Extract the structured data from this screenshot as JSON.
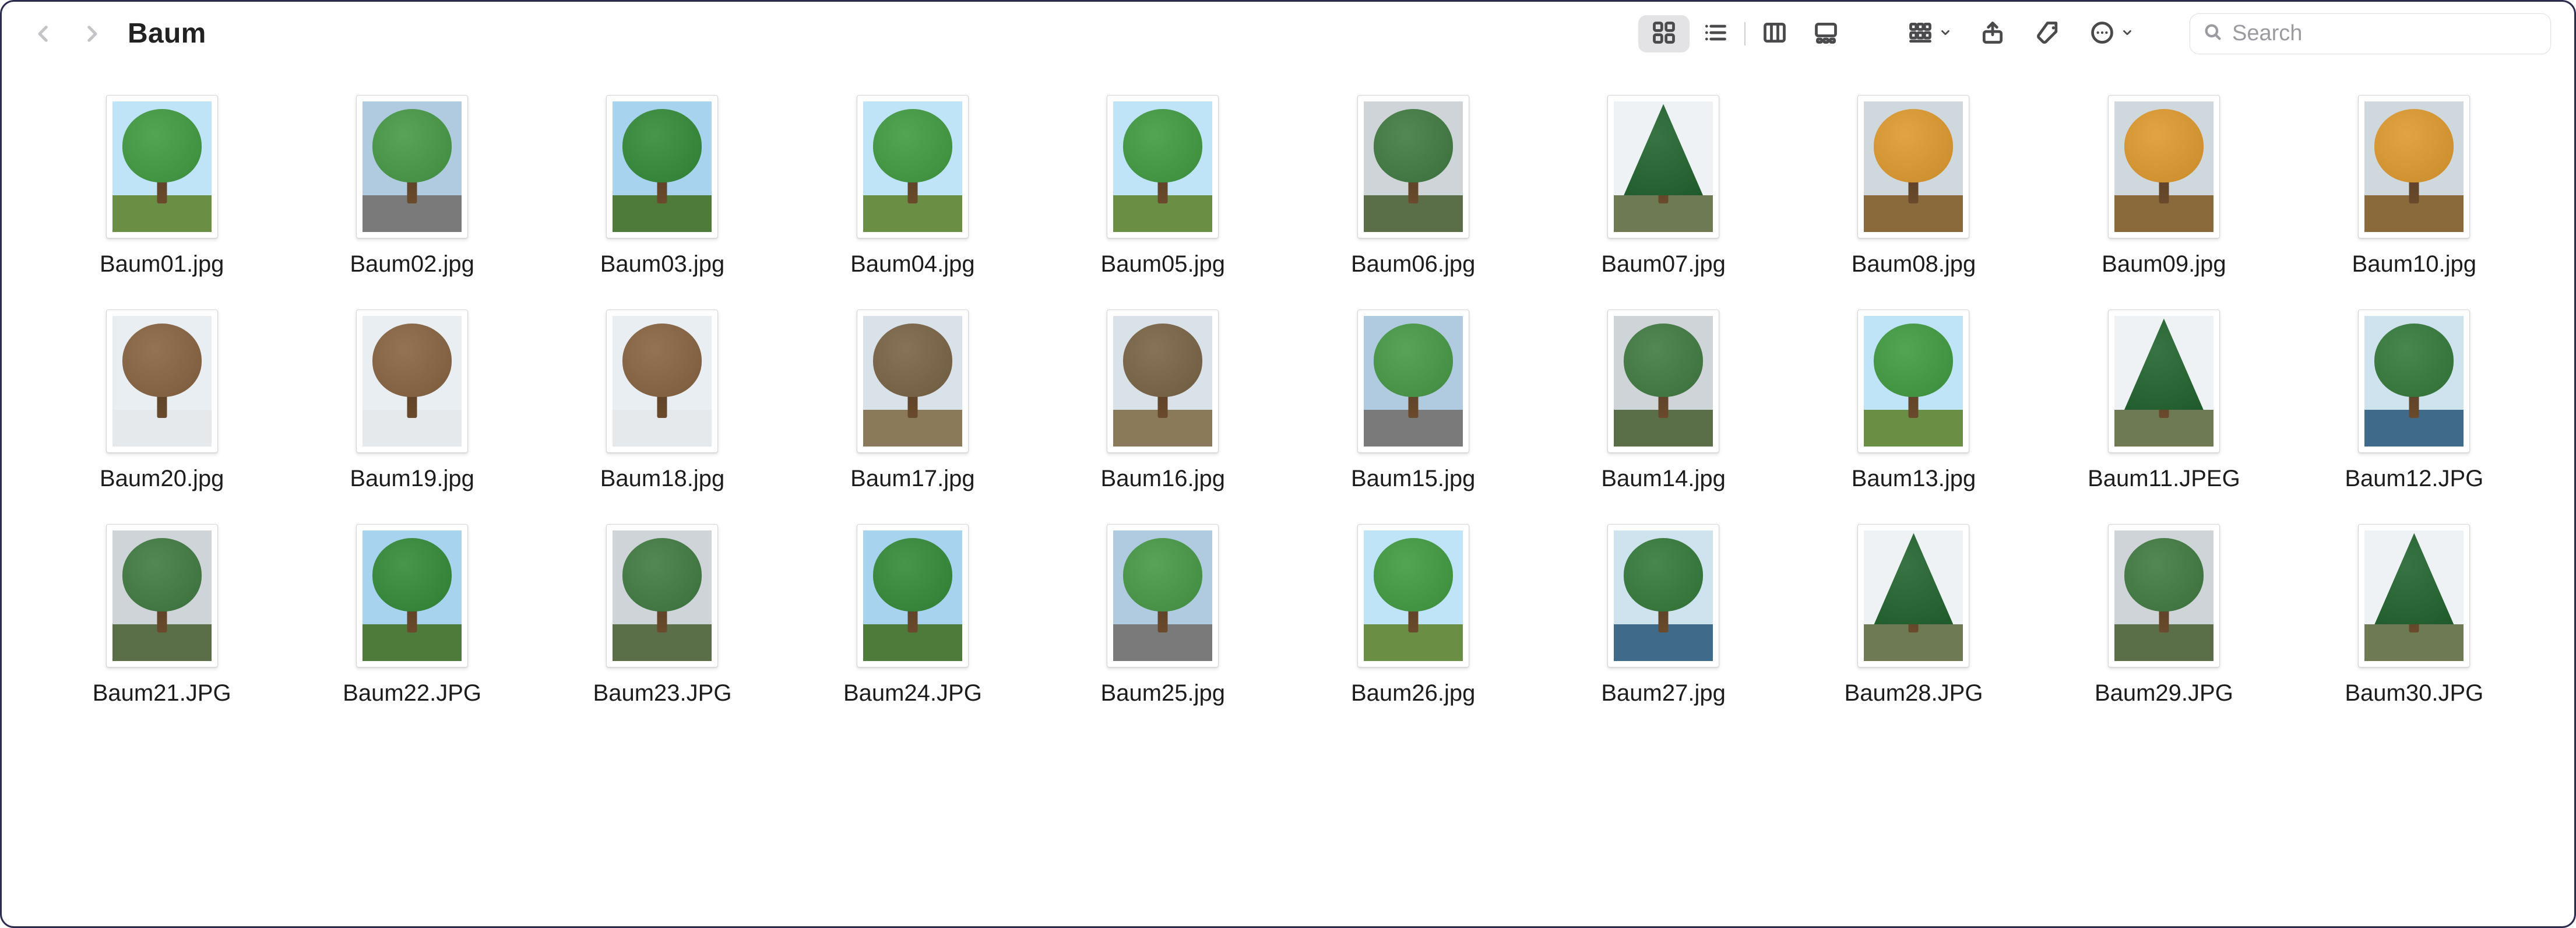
{
  "header": {
    "title": "Baum",
    "search_placeholder": "Search"
  },
  "palettes": {
    "spring": {
      "sky": "#a8d3ef",
      "ground": "#4e7a3a",
      "crown": "#2e7d32"
    },
    "summer": {
      "sky": "#bfe3f7",
      "ground": "#6a8f44",
      "crown": "#3a8c3a"
    },
    "autumn": {
      "sky": "#cfd8dc",
      "ground": "#8a6a3a",
      "crown": "#c98a2a"
    },
    "winter": {
      "sky": "#e8eef2",
      "ground": "#e5e9ec",
      "crown": "#7a5a3a"
    },
    "bare": {
      "sky": "#d9e2e8",
      "ground": "#8a7a5a",
      "crown": "#6e5a3e"
    },
    "pine": {
      "sky": "#eef2f4",
      "ground": "#6e7a54",
      "crown": "#1f5a2a"
    },
    "urban": {
      "sky": "#b0cbe0",
      "ground": "#7a7a7a",
      "crown": "#3f8a3f"
    },
    "lake": {
      "sky": "#cfe3ef",
      "ground": "#3f6a8a",
      "crown": "#2f6e34"
    },
    "overcast": {
      "sky": "#cfd4d8",
      "ground": "#5a6e48",
      "crown": "#3a6e3a"
    }
  },
  "files": [
    {
      "name": "Baum01.jpg",
      "palette": "summer",
      "shape": "round"
    },
    {
      "name": "Baum02.jpg",
      "palette": "urban",
      "shape": "round"
    },
    {
      "name": "Baum03.jpg",
      "palette": "spring",
      "shape": "round"
    },
    {
      "name": "Baum04.jpg",
      "palette": "summer",
      "shape": "round"
    },
    {
      "name": "Baum05.jpg",
      "palette": "summer",
      "shape": "round"
    },
    {
      "name": "Baum06.jpg",
      "palette": "overcast",
      "shape": "round"
    },
    {
      "name": "Baum07.jpg",
      "palette": "pine",
      "shape": "pine"
    },
    {
      "name": "Baum08.jpg",
      "palette": "autumn",
      "shape": "round"
    },
    {
      "name": "Baum09.jpg",
      "palette": "autumn",
      "shape": "round"
    },
    {
      "name": "Baum10.jpg",
      "palette": "autumn",
      "shape": "round"
    },
    {
      "name": "Baum20.jpg",
      "palette": "winter",
      "shape": "round"
    },
    {
      "name": "Baum19.jpg",
      "palette": "winter",
      "shape": "round"
    },
    {
      "name": "Baum18.jpg",
      "palette": "winter",
      "shape": "round"
    },
    {
      "name": "Baum17.jpg",
      "palette": "bare",
      "shape": "round"
    },
    {
      "name": "Baum16.jpg",
      "palette": "bare",
      "shape": "round"
    },
    {
      "name": "Baum15.jpg",
      "palette": "urban",
      "shape": "round"
    },
    {
      "name": "Baum14.jpg",
      "palette": "overcast",
      "shape": "round"
    },
    {
      "name": "Baum13.jpg",
      "palette": "summer",
      "shape": "round"
    },
    {
      "name": "Baum11.JPEG",
      "palette": "pine",
      "shape": "pine"
    },
    {
      "name": "Baum12.JPG",
      "palette": "lake",
      "shape": "round"
    },
    {
      "name": "Baum21.JPG",
      "palette": "overcast",
      "shape": "round"
    },
    {
      "name": "Baum22.JPG",
      "palette": "spring",
      "shape": "round"
    },
    {
      "name": "Baum23.JPG",
      "palette": "overcast",
      "shape": "round"
    },
    {
      "name": "Baum24.JPG",
      "palette": "spring",
      "shape": "round"
    },
    {
      "name": "Baum25.jpg",
      "palette": "urban",
      "shape": "round"
    },
    {
      "name": "Baum26.jpg",
      "palette": "summer",
      "shape": "round"
    },
    {
      "name": "Baum27.jpg",
      "palette": "lake",
      "shape": "round"
    },
    {
      "name": "Baum28.JPG",
      "palette": "pine",
      "shape": "pine"
    },
    {
      "name": "Baum29.JPG",
      "palette": "overcast",
      "shape": "round"
    },
    {
      "name": "Baum30.JPG",
      "palette": "pine",
      "shape": "pine"
    }
  ]
}
